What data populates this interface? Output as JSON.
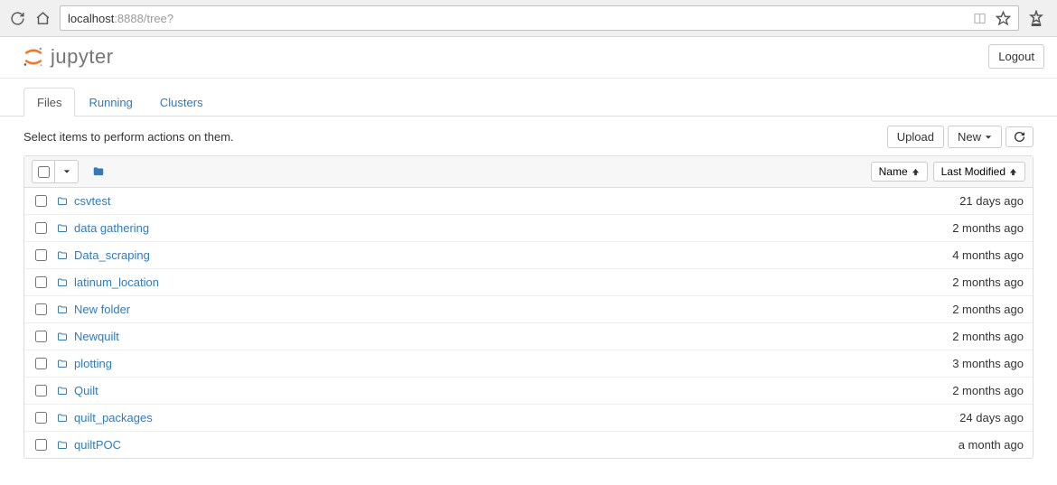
{
  "url": {
    "host": "localhost",
    "portpath": ":8888/tree?"
  },
  "header": {
    "brand": "jupyter",
    "logout": "Logout"
  },
  "tabs": [
    {
      "label": "Files",
      "active": true
    },
    {
      "label": "Running",
      "active": false
    },
    {
      "label": "Clusters",
      "active": false
    }
  ],
  "toolbar": {
    "hint": "Select items to perform actions on them.",
    "upload": "Upload",
    "new": "New"
  },
  "columns": {
    "name": "Name",
    "modified": "Last Modified"
  },
  "items": [
    {
      "name": "csvtest",
      "modified": "21 days ago"
    },
    {
      "name": "data gathering",
      "modified": "2 months ago"
    },
    {
      "name": "Data_scraping",
      "modified": "4 months ago"
    },
    {
      "name": "latinum_location",
      "modified": "2 months ago"
    },
    {
      "name": "New folder",
      "modified": "2 months ago"
    },
    {
      "name": "Newquilt",
      "modified": "2 months ago"
    },
    {
      "name": "plotting",
      "modified": "3 months ago"
    },
    {
      "name": "Quilt",
      "modified": "2 months ago"
    },
    {
      "name": "quilt_packages",
      "modified": "24 days ago"
    },
    {
      "name": "quiltPOC",
      "modified": "a month ago"
    }
  ]
}
